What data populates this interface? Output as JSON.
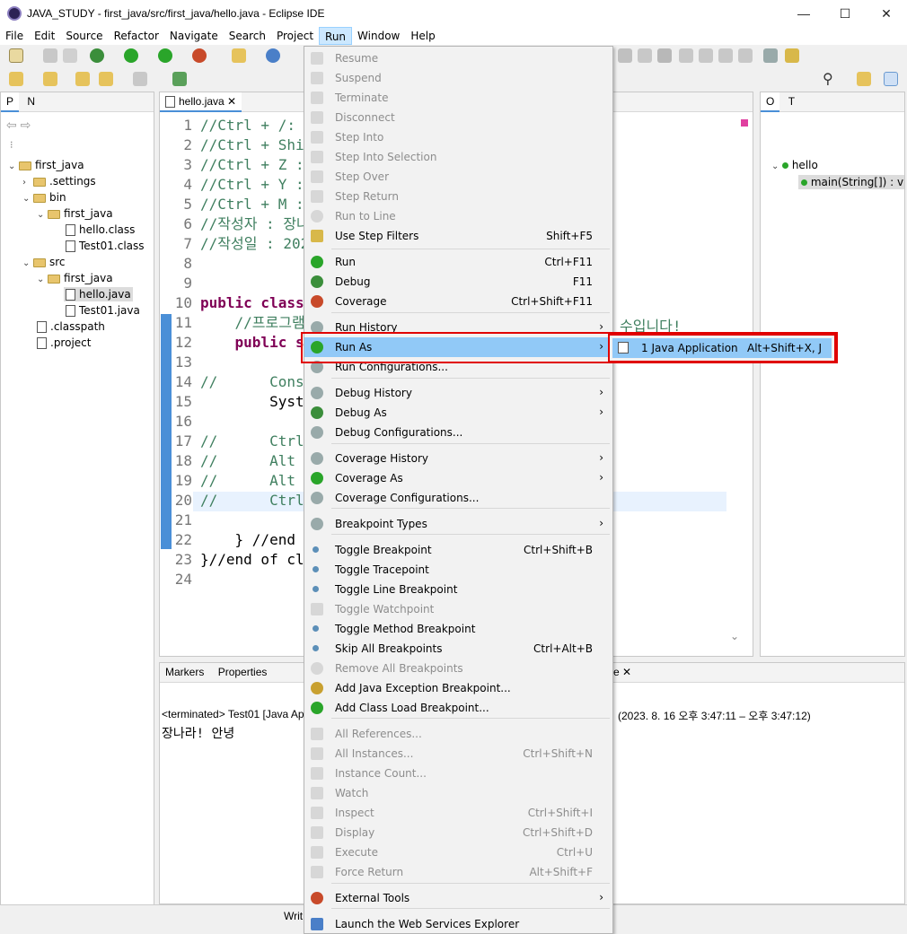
{
  "window": {
    "title": "JAVA_STUDY - first_java/src/first_java/hello.java - Eclipse IDE",
    "minimize": "—",
    "maximize": "☐",
    "close": "✕"
  },
  "menubar": [
    "File",
    "Edit",
    "Source",
    "Refactor",
    "Navigate",
    "Search",
    "Project",
    "Run",
    "Window",
    "Help"
  ],
  "left_panel": {
    "tabs": [
      "P",
      "N"
    ],
    "tree": [
      {
        "label": "first_java",
        "kind": "project"
      },
      {
        "label": ".settings",
        "kind": "folder"
      },
      {
        "label": "bin",
        "kind": "folder"
      },
      {
        "label": "first_java",
        "kind": "folder"
      },
      {
        "label": "hello.class",
        "kind": "class"
      },
      {
        "label": "Test01.class",
        "kind": "class"
      },
      {
        "label": "src",
        "kind": "folder"
      },
      {
        "label": "first_java",
        "kind": "folder"
      },
      {
        "label": "hello.java",
        "kind": "java"
      },
      {
        "label": "Test01.java",
        "kind": "java"
      },
      {
        "label": ".classpath",
        "kind": "xml"
      },
      {
        "label": ".project",
        "kind": "xml"
      }
    ]
  },
  "editor": {
    "tab": "hello.java",
    "lines": [
      {
        "n": "1",
        "text": "//Ctrl + /:"
      },
      {
        "n": "2",
        "text": "//Ctrl + Shi"
      },
      {
        "n": "3",
        "text": "//Ctrl + Z :"
      },
      {
        "n": "4",
        "text": "//Ctrl + Y :"
      },
      {
        "n": "5",
        "text": "//Ctrl + M :"
      },
      {
        "n": "6",
        "text": "//작성자 : 장나"
      },
      {
        "n": "7",
        "text": "//작성일 : 202"
      },
      {
        "n": "8",
        "text": ""
      },
      {
        "n": "9",
        "text": ""
      },
      {
        "n": "10",
        "text": "public class"
      },
      {
        "n": "11",
        "text": "    //프로그램"
      },
      {
        "n": "12",
        "text": "    public s"
      },
      {
        "n": "13",
        "text": ""
      },
      {
        "n": "14",
        "text": "//      Cons"
      },
      {
        "n": "15",
        "text": "        Syst"
      },
      {
        "n": "16",
        "text": ""
      },
      {
        "n": "17",
        "text": "//      Ctrl"
      },
      {
        "n": "18",
        "text": "//      Alt"
      },
      {
        "n": "19",
        "text": "//      Alt"
      },
      {
        "n": "20",
        "text": "//      Ctrl"
      },
      {
        "n": "21",
        "text": ""
      },
      {
        "n": "22",
        "text": "    } //end"
      },
      {
        "n": "23",
        "text": "}//end of cl"
      },
      {
        "n": "24",
        "text": ""
      }
    ],
    "right_fragment": "수입니다!"
  },
  "outline": {
    "tabs": [
      "O",
      "T"
    ],
    "class": "hello",
    "method": "main(String[]) : v"
  },
  "bottom": {
    "tabs": [
      "Markers",
      "Properties"
    ],
    "console_tab_fragment": "e",
    "terminated": "<terminated> Test01 [Java Ap",
    "time": "(2023. 8. 16 오후 3:47:11 – 오후 3:47:12)",
    "output": "장나라!  안녕",
    "status": "Writ"
  },
  "run_menu": {
    "items": [
      {
        "label": "Resume",
        "sc": "",
        "dis": true
      },
      {
        "label": "Suspend",
        "sc": "",
        "dis": true
      },
      {
        "label": "Terminate",
        "sc": "",
        "dis": true
      },
      {
        "label": "Disconnect",
        "sc": "",
        "dis": true
      },
      {
        "label": "Step Into",
        "sc": "",
        "dis": true
      },
      {
        "label": "Step Into Selection",
        "sc": "",
        "dis": true
      },
      {
        "label": "Step Over",
        "sc": "",
        "dis": true
      },
      {
        "label": "Step Return",
        "sc": "",
        "dis": true
      },
      {
        "label": "Run to Line",
        "sc": "",
        "dis": true
      },
      {
        "label": "Use Step Filters",
        "sc": "Shift+F5",
        "dis": false
      },
      {
        "label": "Run",
        "sc": "Ctrl+F11",
        "dis": false
      },
      {
        "label": "Debug",
        "sc": "F11",
        "dis": false
      },
      {
        "label": "Coverage",
        "sc": "Ctrl+Shift+F11",
        "dis": false
      },
      {
        "label": "Run History",
        "sc": "",
        "dis": false,
        "sub": true
      },
      {
        "label": "Run As",
        "sc": "",
        "dis": false,
        "sub": true,
        "hl": true
      },
      {
        "label": "Run Configurations...",
        "sc": "",
        "dis": false
      },
      {
        "label": "Debug History",
        "sc": "",
        "dis": false,
        "sub": true
      },
      {
        "label": "Debug As",
        "sc": "",
        "dis": false,
        "sub": true
      },
      {
        "label": "Debug Configurations...",
        "sc": "",
        "dis": false
      },
      {
        "label": "Coverage History",
        "sc": "",
        "dis": false,
        "sub": true
      },
      {
        "label": "Coverage As",
        "sc": "",
        "dis": false,
        "sub": true
      },
      {
        "label": "Coverage Configurations...",
        "sc": "",
        "dis": false
      },
      {
        "label": "Breakpoint Types",
        "sc": "",
        "dis": false,
        "sub": true
      },
      {
        "label": "Toggle Breakpoint",
        "sc": "Ctrl+Shift+B",
        "dis": false
      },
      {
        "label": "Toggle Tracepoint",
        "sc": "",
        "dis": false
      },
      {
        "label": "Toggle Line Breakpoint",
        "sc": "",
        "dis": false
      },
      {
        "label": "Toggle Watchpoint",
        "sc": "",
        "dis": true
      },
      {
        "label": "Toggle Method Breakpoint",
        "sc": "",
        "dis": false
      },
      {
        "label": "Skip All Breakpoints",
        "sc": "Ctrl+Alt+B",
        "dis": false
      },
      {
        "label": "Remove All Breakpoints",
        "sc": "",
        "dis": true
      },
      {
        "label": "Add Java Exception Breakpoint...",
        "sc": "",
        "dis": false
      },
      {
        "label": "Add Class Load Breakpoint...",
        "sc": "",
        "dis": false
      },
      {
        "label": "All References...",
        "sc": "",
        "dis": true
      },
      {
        "label": "All Instances...",
        "sc": "Ctrl+Shift+N",
        "dis": true
      },
      {
        "label": "Instance Count...",
        "sc": "",
        "dis": true
      },
      {
        "label": "Watch",
        "sc": "",
        "dis": true
      },
      {
        "label": "Inspect",
        "sc": "Ctrl+Shift+I",
        "dis": true
      },
      {
        "label": "Display",
        "sc": "Ctrl+Shift+D",
        "dis": true
      },
      {
        "label": "Execute",
        "sc": "Ctrl+U",
        "dis": true
      },
      {
        "label": "Force Return",
        "sc": "Alt+Shift+F",
        "dis": true
      },
      {
        "label": "External Tools",
        "sc": "",
        "dis": false,
        "sub": true
      },
      {
        "label": "Launch the Web Services Explorer",
        "sc": "",
        "dis": false
      }
    ]
  },
  "submenu": {
    "label": "1 Java Application",
    "shortcut": "Alt+Shift+X, J"
  }
}
